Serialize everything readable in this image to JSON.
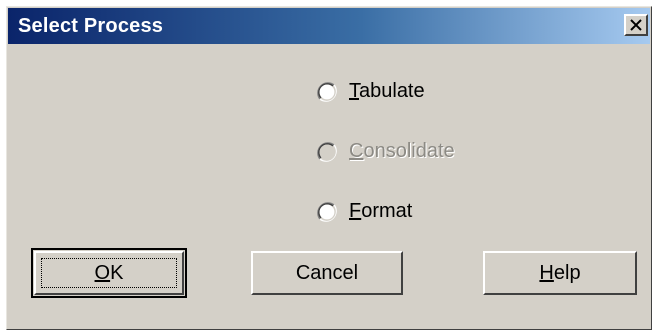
{
  "dialog": {
    "title": "Select Process"
  },
  "options": [
    {
      "mnemonic": "T",
      "rest": "abulate",
      "enabled": true,
      "selected": false
    },
    {
      "mnemonic": "C",
      "rest": "onsolidate",
      "enabled": false,
      "selected": false
    },
    {
      "mnemonic": "F",
      "rest": "ormat",
      "enabled": true,
      "selected": false
    }
  ],
  "buttons": {
    "ok": {
      "mnemonic": "O",
      "rest": "K"
    },
    "cancel": {
      "label": "Cancel"
    },
    "help": {
      "mnemonic": "H",
      "rest": "elp"
    }
  },
  "colors": {
    "title_gradient_start": "#0a246a",
    "title_gradient_end": "#a6caf0",
    "face": "#d4d0c8",
    "disabled_text": "#8c8a84"
  }
}
